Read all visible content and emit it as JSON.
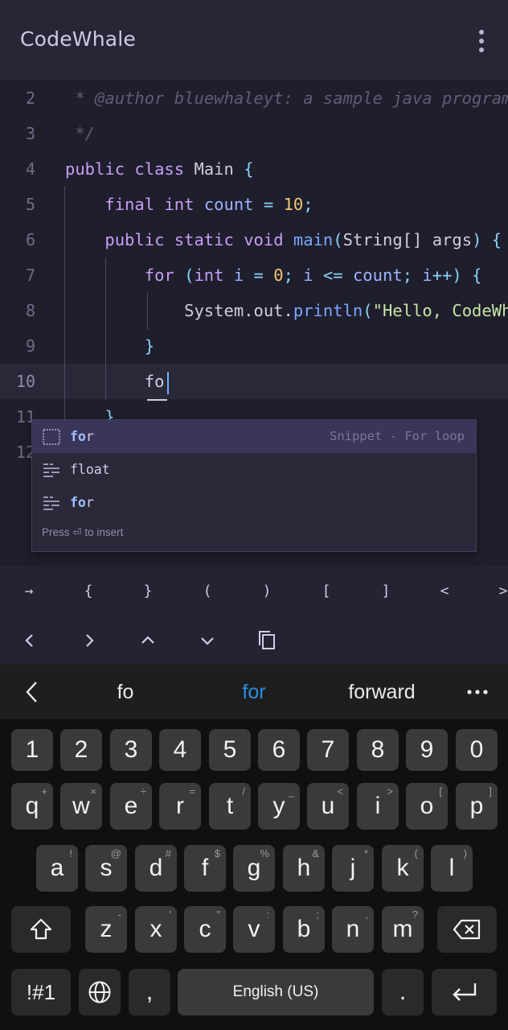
{
  "app": {
    "title": "CodeWhale"
  },
  "editor": {
    "lines": [
      {
        "num": "2",
        "text": " * @author bluewhaleyt: a sample java program"
      },
      {
        "num": "3",
        "text": " */"
      },
      {
        "num": "4",
        "text": "public class Main {"
      },
      {
        "num": "5",
        "text": "    final int count = 10;"
      },
      {
        "num": "6",
        "text": "    public static void main(String[] args) {"
      },
      {
        "num": "7",
        "text": "        for (int i = 0; i <= count; i++) {"
      },
      {
        "num": "8",
        "text": "            System.out.println(\"Hello, CodeWhale\");"
      },
      {
        "num": "9",
        "text": "        }"
      },
      {
        "num": "10",
        "text": "        fo"
      },
      {
        "num": "11",
        "text": "    }"
      },
      {
        "num": "12",
        "text": ""
      }
    ],
    "active_line": "10"
  },
  "autocomplete": {
    "items": [
      {
        "label": "for",
        "match": "fo",
        "rest": "r",
        "detail": "Snippet - For loop",
        "icon": "snippet-icon",
        "selected": true
      },
      {
        "label": "float",
        "match": "",
        "rest": "float",
        "detail": "",
        "icon": "keyword-icon",
        "selected": false
      },
      {
        "label": "for",
        "match": "fo",
        "rest": "r",
        "detail": "",
        "icon": "keyword-icon",
        "selected": false
      }
    ],
    "hint": "Press ⏎ to insert"
  },
  "symbols": [
    "→",
    "{",
    "}",
    "(",
    ")",
    "[",
    "]",
    "<",
    ">"
  ],
  "nav_buttons": [
    "chevron-left-icon",
    "chevron-right-icon",
    "chevron-up-icon",
    "chevron-down-icon",
    "copy-icon"
  ],
  "keyboard": {
    "suggestions": [
      "fo",
      "for",
      "forward"
    ],
    "highlighted_suggestion": "for",
    "row_numbers": [
      "1",
      "2",
      "3",
      "4",
      "5",
      "6",
      "7",
      "8",
      "9",
      "0"
    ],
    "row1": [
      {
        "k": "q",
        "s": "+"
      },
      {
        "k": "w",
        "s": "×"
      },
      {
        "k": "e",
        "s": "÷"
      },
      {
        "k": "r",
        "s": "="
      },
      {
        "k": "t",
        "s": "/"
      },
      {
        "k": "y",
        "s": "_"
      },
      {
        "k": "u",
        "s": "<"
      },
      {
        "k": "i",
        "s": ">"
      },
      {
        "k": "o",
        "s": "["
      },
      {
        "k": "p",
        "s": "]"
      }
    ],
    "row2": [
      {
        "k": "a",
        "s": "!"
      },
      {
        "k": "s",
        "s": "@"
      },
      {
        "k": "d",
        "s": "#"
      },
      {
        "k": "f",
        "s": "$"
      },
      {
        "k": "g",
        "s": "%"
      },
      {
        "k": "h",
        "s": "&"
      },
      {
        "k": "j",
        "s": "*"
      },
      {
        "k": "k",
        "s": "("
      },
      {
        "k": "l",
        "s": ")"
      }
    ],
    "row3": [
      {
        "k": "z",
        "s": "-"
      },
      {
        "k": "x",
        "s": "'"
      },
      {
        "k": "c",
        "s": "\""
      },
      {
        "k": "v",
        "s": ":"
      },
      {
        "k": "b",
        "s": ";"
      },
      {
        "k": "n",
        "s": ","
      },
      {
        "k": "m",
        "s": "?"
      }
    ],
    "symbols_key": "!#1",
    "comma_key": ",",
    "space_label": "English (US)",
    "period_key": "."
  },
  "colors": {
    "accent": "#7aa7ff",
    "keyword": "#c69ff5",
    "number": "#f0c674",
    "string": "#c9e6a6",
    "suggestion_highlight": "#2a8fe0"
  }
}
